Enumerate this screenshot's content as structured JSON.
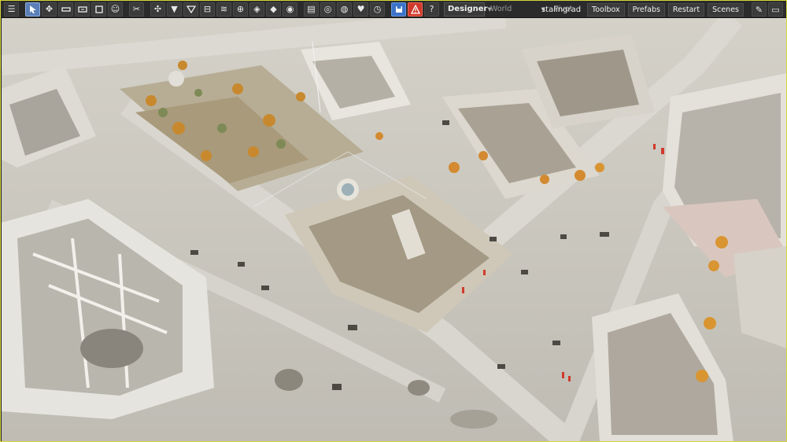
{
  "toolbar": {
    "mode": "Designer",
    "space": "World",
    "pivot": "Pivot",
    "scene_name": "stalingrad",
    "buttons": {
      "toolbox": "Toolbox",
      "prefabs": "Prefabs",
      "restart": "Restart",
      "scenes": "Scenes"
    }
  },
  "colors": {
    "frame_border": "#d6d63a",
    "toolbar_bg": "#2b2b2b",
    "active_tool": "#5b7fb8",
    "save_button": "#3c73c9",
    "warning_button": "#d03a2c"
  },
  "icons": [
    "menu-icon",
    "select-icon",
    "move-icon",
    "rotate-icon",
    "scale-icon",
    "rect-icon",
    "smile-icon",
    "scissors-icon",
    "grid-snap-icon",
    "funnel-icon",
    "filter-icon",
    "align-icon",
    "terrain-icon",
    "target-icon",
    "diamond-icon",
    "layer-icon",
    "paint-icon",
    "doc-icon",
    "eye-icon",
    "eye-alt-icon",
    "heart-icon",
    "stopwatch-icon",
    "save-icon",
    "warning-icon",
    "help-icon",
    "wrench-icon"
  ]
}
